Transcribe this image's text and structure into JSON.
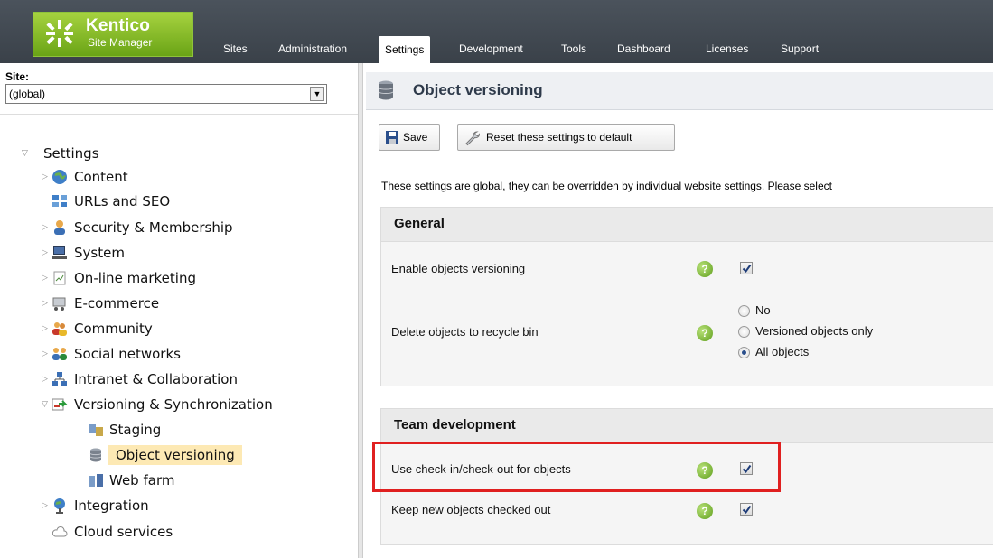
{
  "app": {
    "brand": "Kentico",
    "subtitle": "Site Manager"
  },
  "nav": {
    "tabs": [
      {
        "label": "Sites"
      },
      {
        "label": "Administration"
      },
      {
        "label": "Settings"
      },
      {
        "label": "Development"
      },
      {
        "label": "Tools"
      },
      {
        "label": "Dashboard"
      },
      {
        "label": "Licenses"
      },
      {
        "label": "Support"
      }
    ],
    "active": "Settings"
  },
  "sidebar": {
    "site_label": "Site:",
    "site_value": "(global)",
    "root": "Settings",
    "items": [
      {
        "label": "Content",
        "icon": "globe-icon"
      },
      {
        "label": "URLs and SEO",
        "icon": "sitemap-icon"
      },
      {
        "label": "Security & Membership",
        "icon": "user-icon"
      },
      {
        "label": "System",
        "icon": "computer-icon"
      },
      {
        "label": "On-line marketing",
        "icon": "chart-icon"
      },
      {
        "label": "E-commerce",
        "icon": "cart-icon"
      },
      {
        "label": "Community",
        "icon": "group-icon"
      },
      {
        "label": "Social networks",
        "icon": "people-icon"
      },
      {
        "label": "Intranet & Collaboration",
        "icon": "network-icon"
      },
      {
        "label": "Versioning & Synchronization",
        "icon": "sync-icon"
      },
      {
        "label": "Staging",
        "icon": "staging-icon"
      },
      {
        "label": "Object versioning",
        "icon": "database-icon"
      },
      {
        "label": "Web farm",
        "icon": "server-icon"
      },
      {
        "label": "Integration",
        "icon": "integration-icon"
      },
      {
        "label": "Cloud services",
        "icon": "cloud-icon"
      }
    ]
  },
  "main": {
    "title": "Object versioning",
    "toolbar": {
      "save": "Save",
      "reset": "Reset these settings to default"
    },
    "description": "These settings are global, they can be overridden by individual website settings. Please select",
    "groups": [
      {
        "title": "General",
        "settings": [
          {
            "label": "Enable objects versioning",
            "checked": true
          },
          {
            "label": "Delete objects to recycle bin",
            "options": [
              "No",
              "Versioned objects only",
              "All objects"
            ],
            "selected": "All objects"
          }
        ]
      },
      {
        "title": "Team development",
        "settings": [
          {
            "label": "Use check-in/check-out for objects",
            "checked": true
          },
          {
            "label": "Keep new objects checked out",
            "checked": true
          }
        ]
      }
    ],
    "help_glyph": "?"
  },
  "colors": {
    "topbar": "#3f464e",
    "logo_green": "#8cc63f",
    "highlight": "#e02020",
    "selected_node": "#fde9b4"
  }
}
